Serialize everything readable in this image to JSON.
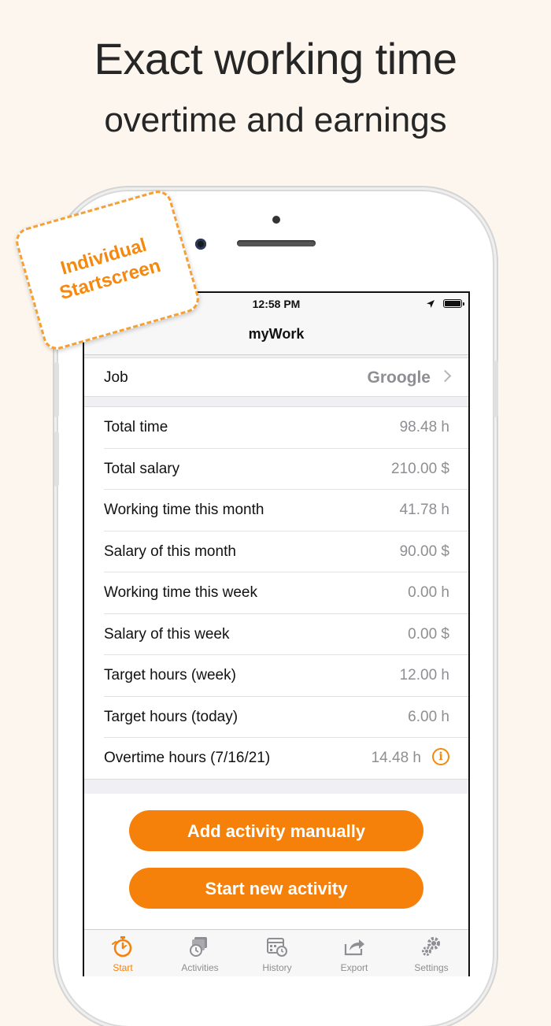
{
  "headline": {
    "title": "Exact working time",
    "subtitle": "overtime and earnings"
  },
  "badge": {
    "line1": "Individual",
    "line2": "Startscreen"
  },
  "status_bar": {
    "time": "12:58 PM"
  },
  "nav": {
    "title": "myWork"
  },
  "job": {
    "label": "Job",
    "value": "Groogle"
  },
  "stats": [
    {
      "label": "Total time",
      "value": "98.48 h"
    },
    {
      "label": "Total salary",
      "value": "210.00 $"
    },
    {
      "label": "Working time this month",
      "value": "41.78 h"
    },
    {
      "label": "Salary of this month",
      "value": "90.00 $"
    },
    {
      "label": "Working time this week",
      "value": "0.00 h"
    },
    {
      "label": "Salary of this week",
      "value": "0.00 $"
    },
    {
      "label": "Target hours (week)",
      "value": "12.00 h"
    },
    {
      "label": "Target hours (today)",
      "value": "6.00 h"
    },
    {
      "label": "Overtime hours (7/16/21)",
      "value": "14.48 h"
    }
  ],
  "actions": {
    "add_manual": "Add activity manually",
    "start_new": "Start new activity"
  },
  "tabs": [
    {
      "label": "Start",
      "icon": "stopwatch-icon",
      "active": true
    },
    {
      "label": "Activities",
      "icon": "activities-icon",
      "active": false
    },
    {
      "label": "History",
      "icon": "calendar-clock-icon",
      "active": false
    },
    {
      "label": "Export",
      "icon": "export-icon",
      "active": false
    },
    {
      "label": "Settings",
      "icon": "gear-icon",
      "active": false
    }
  ],
  "colors": {
    "accent": "#f5810b",
    "background": "#fdf6ee",
    "secondary_text": "#8e8e93"
  }
}
